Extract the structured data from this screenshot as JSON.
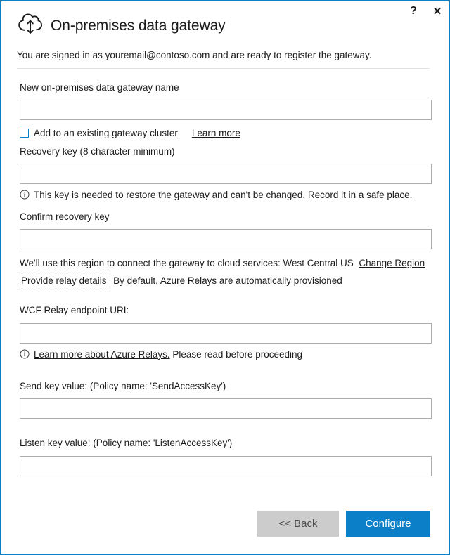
{
  "window": {
    "border_color": "#0b7fc7",
    "help_glyph": "?",
    "close_glyph": "✕",
    "help_label": "Help",
    "close_label": "Close"
  },
  "header": {
    "icon": "cloud-updown-arrow-icon",
    "title": "On-premises data gateway",
    "signin_text": "You are signed in as youremail@contoso.com and are ready to register the gateway."
  },
  "form": {
    "gateway_name": {
      "label": "New on-premises data gateway name",
      "value": "",
      "placeholder": ""
    },
    "cluster_checkbox": {
      "label": "Add to an existing gateway cluster",
      "checked": false,
      "learn_more_label": "Learn more"
    },
    "recovery_key": {
      "label": "Recovery key (8 character minimum)",
      "value": "",
      "placeholder": "",
      "helper_icon": "info-icon",
      "helper_text": "This key is needed to restore the gateway and can't be changed. Record it in a safe place."
    },
    "confirm_recovery_key": {
      "label": "Confirm recovery key",
      "value": "",
      "placeholder": ""
    },
    "region": {
      "text": "We'll use this region to connect the gateway to cloud services: West Central US",
      "region_value": "West Central US",
      "change_link_label": "Change Region"
    },
    "relay": {
      "link_label": "Provide relay details",
      "description": "By default, Azure Relays are automatically provisioned",
      "focused": true
    },
    "wcf_relay_uri": {
      "label": "WCF Relay endpoint URI:",
      "value": "",
      "placeholder": "",
      "helper_icon": "info-icon",
      "helper_link_label": "Learn more about Azure Relays.",
      "helper_text": "Please read before proceeding"
    },
    "send_key": {
      "label": "Send key value: (Policy name: 'SendAccessKey')",
      "value": "",
      "placeholder": ""
    },
    "listen_key": {
      "label": "Listen key value: (Policy name: 'ListenAccessKey')",
      "value": "",
      "placeholder": ""
    }
  },
  "footer": {
    "back_label": "<< Back",
    "configure_label": "Configure",
    "back_color": "#cccccc",
    "configure_color": "#0b7fc7"
  }
}
